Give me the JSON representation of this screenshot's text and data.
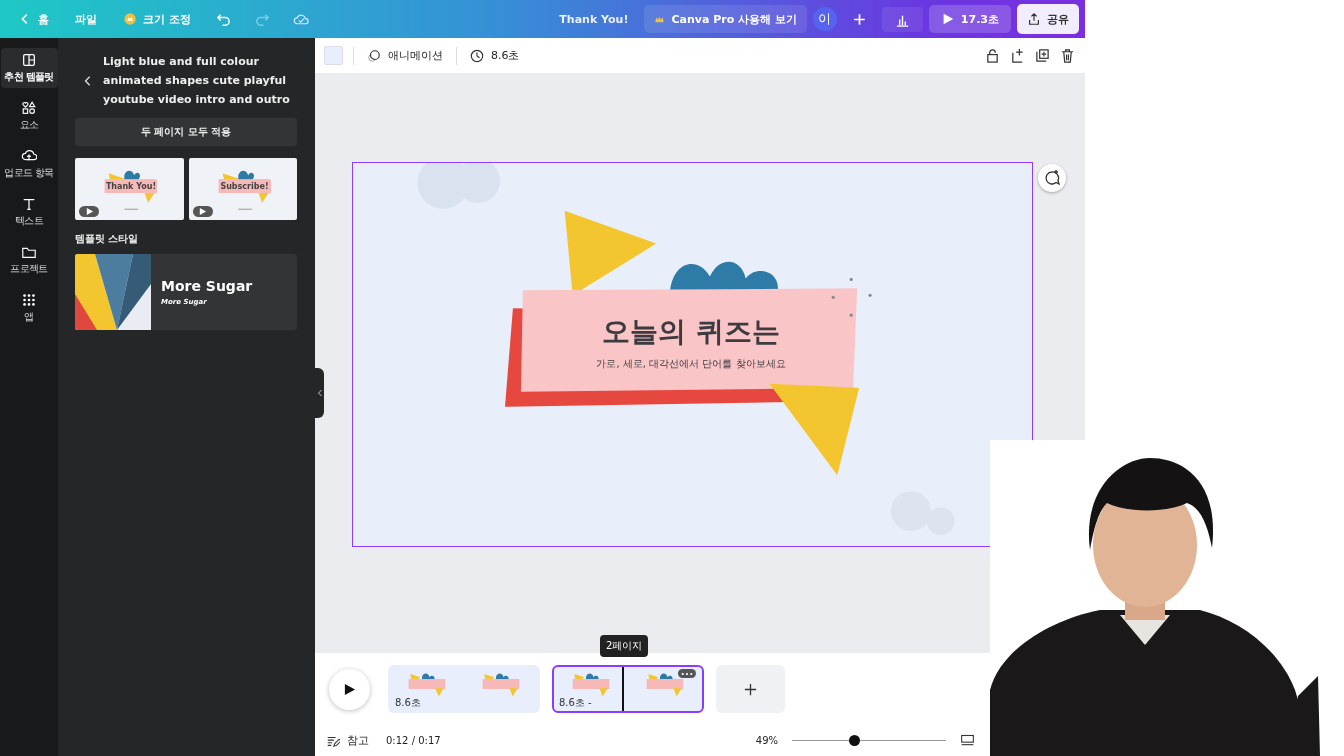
{
  "topbar": {
    "back": "홈",
    "menu": "파일",
    "resize": "크기 조정",
    "title": "Thank You!",
    "pro": "Canva Pro 사용해 보기",
    "avatar": "이",
    "play": "17.3초",
    "share": "공유"
  },
  "sidebar": [
    {
      "label": "추천 템플릿",
      "selected": true
    },
    {
      "label": "요소",
      "selected": false
    },
    {
      "label": "업로드 항목",
      "selected": false
    },
    {
      "label": "텍스트",
      "selected": false
    },
    {
      "label": "프로젝트",
      "selected": false
    },
    {
      "label": "앱",
      "selected": false
    }
  ],
  "panel": {
    "title": "Light blue and full colour animated shapes cute playful youtube video intro and outro",
    "apply": "두 페이지 모두 적용",
    "thumbnails": [
      {
        "caption": "Thank You!"
      },
      {
        "caption": "Subscribe!"
      }
    ],
    "section": "템플릿 스타일",
    "style": {
      "title": "More Sugar",
      "subtitle": "More Sugar"
    }
  },
  "toolbar": {
    "animation": "애니메이션",
    "duration": "8.6초"
  },
  "canvas": {
    "heading": "오늘의 퀴즈는",
    "subheading": "가로, 세로, 대각선에서 단어를 찾아보세요"
  },
  "timeline": {
    "tooltip": "2페이지",
    "pages": [
      {
        "duration": "8.6초",
        "selected": false
      },
      {
        "duration": "8.6초 -",
        "selected": true
      }
    ]
  },
  "footer": {
    "notes": "참고",
    "time": "0:12 / 0:17",
    "zoom": "49%",
    "level": 0.4
  }
}
